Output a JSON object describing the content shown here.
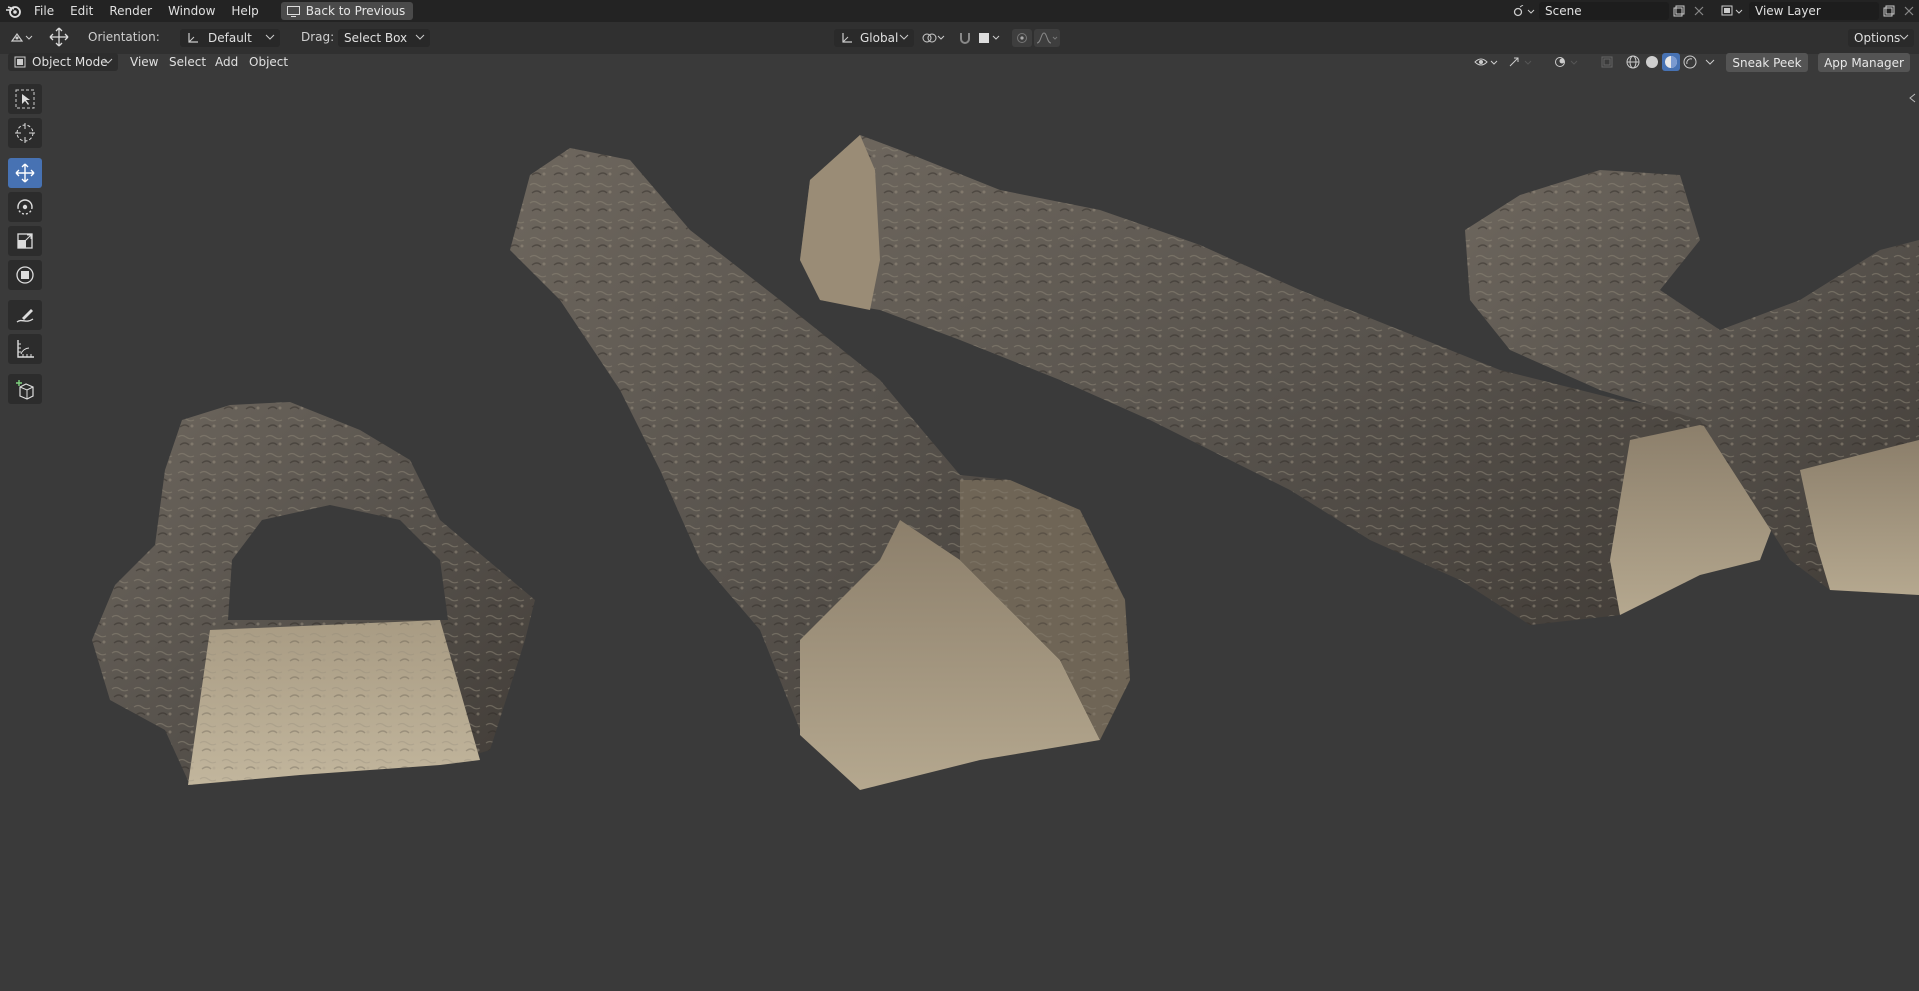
{
  "topbar": {
    "menus": [
      "File",
      "Edit",
      "Render",
      "Window",
      "Help"
    ],
    "back_button": "Back to Previous",
    "scene_field": "Scene",
    "view_layer_field": "View Layer"
  },
  "tool_header": {
    "orientation_label": "Orientation:",
    "orientation_value": "Default",
    "drag_label": "Drag:",
    "drag_value": "Select Box",
    "transform_orientation": "Global",
    "options_label": "Options"
  },
  "viewport_header": {
    "mode": "Object Mode",
    "menus": [
      "View",
      "Select",
      "Add",
      "Object"
    ],
    "sneak_peek": "Sneak Peek",
    "app_manager": "App Manager"
  },
  "toolbar": {
    "tools": [
      "select-box-icon",
      "cursor-icon",
      "move-icon",
      "rotate-icon",
      "scale-icon",
      "transform-icon",
      "annotate-icon",
      "measure-icon",
      "add-cube-icon"
    ],
    "active_tool": "move-icon"
  },
  "colors": {
    "background": "#3a3a3a",
    "topbar": "#232323",
    "accent": "#4772b3",
    "rock_light": "#a8977a",
    "rock_dark": "#4f4a44"
  }
}
